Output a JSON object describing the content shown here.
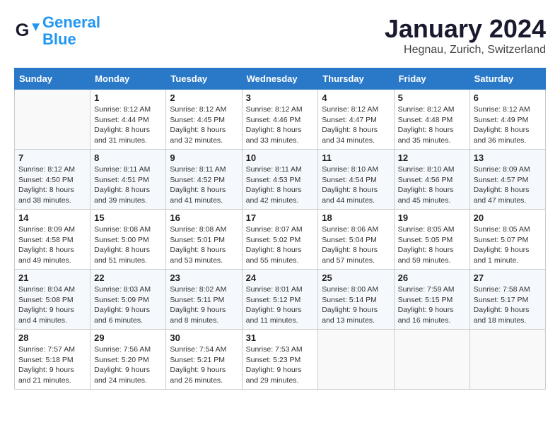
{
  "header": {
    "logo_line1": "General",
    "logo_line2": "Blue",
    "month_title": "January 2024",
    "location": "Hegnau, Zurich, Switzerland"
  },
  "weekdays": [
    "Sunday",
    "Monday",
    "Tuesday",
    "Wednesday",
    "Thursday",
    "Friday",
    "Saturday"
  ],
  "weeks": [
    [
      {
        "day": "",
        "info": ""
      },
      {
        "day": "1",
        "info": "Sunrise: 8:12 AM\nSunset: 4:44 PM\nDaylight: 8 hours\nand 31 minutes."
      },
      {
        "day": "2",
        "info": "Sunrise: 8:12 AM\nSunset: 4:45 PM\nDaylight: 8 hours\nand 32 minutes."
      },
      {
        "day": "3",
        "info": "Sunrise: 8:12 AM\nSunset: 4:46 PM\nDaylight: 8 hours\nand 33 minutes."
      },
      {
        "day": "4",
        "info": "Sunrise: 8:12 AM\nSunset: 4:47 PM\nDaylight: 8 hours\nand 34 minutes."
      },
      {
        "day": "5",
        "info": "Sunrise: 8:12 AM\nSunset: 4:48 PM\nDaylight: 8 hours\nand 35 minutes."
      },
      {
        "day": "6",
        "info": "Sunrise: 8:12 AM\nSunset: 4:49 PM\nDaylight: 8 hours\nand 36 minutes."
      }
    ],
    [
      {
        "day": "7",
        "info": "Sunrise: 8:12 AM\nSunset: 4:50 PM\nDaylight: 8 hours\nand 38 minutes."
      },
      {
        "day": "8",
        "info": "Sunrise: 8:11 AM\nSunset: 4:51 PM\nDaylight: 8 hours\nand 39 minutes."
      },
      {
        "day": "9",
        "info": "Sunrise: 8:11 AM\nSunset: 4:52 PM\nDaylight: 8 hours\nand 41 minutes."
      },
      {
        "day": "10",
        "info": "Sunrise: 8:11 AM\nSunset: 4:53 PM\nDaylight: 8 hours\nand 42 minutes."
      },
      {
        "day": "11",
        "info": "Sunrise: 8:10 AM\nSunset: 4:54 PM\nDaylight: 8 hours\nand 44 minutes."
      },
      {
        "day": "12",
        "info": "Sunrise: 8:10 AM\nSunset: 4:56 PM\nDaylight: 8 hours\nand 45 minutes."
      },
      {
        "day": "13",
        "info": "Sunrise: 8:09 AM\nSunset: 4:57 PM\nDaylight: 8 hours\nand 47 minutes."
      }
    ],
    [
      {
        "day": "14",
        "info": "Sunrise: 8:09 AM\nSunset: 4:58 PM\nDaylight: 8 hours\nand 49 minutes."
      },
      {
        "day": "15",
        "info": "Sunrise: 8:08 AM\nSunset: 5:00 PM\nDaylight: 8 hours\nand 51 minutes."
      },
      {
        "day": "16",
        "info": "Sunrise: 8:08 AM\nSunset: 5:01 PM\nDaylight: 8 hours\nand 53 minutes."
      },
      {
        "day": "17",
        "info": "Sunrise: 8:07 AM\nSunset: 5:02 PM\nDaylight: 8 hours\nand 55 minutes."
      },
      {
        "day": "18",
        "info": "Sunrise: 8:06 AM\nSunset: 5:04 PM\nDaylight: 8 hours\nand 57 minutes."
      },
      {
        "day": "19",
        "info": "Sunrise: 8:05 AM\nSunset: 5:05 PM\nDaylight: 8 hours\nand 59 minutes."
      },
      {
        "day": "20",
        "info": "Sunrise: 8:05 AM\nSunset: 5:07 PM\nDaylight: 9 hours\nand 1 minute."
      }
    ],
    [
      {
        "day": "21",
        "info": "Sunrise: 8:04 AM\nSunset: 5:08 PM\nDaylight: 9 hours\nand 4 minutes."
      },
      {
        "day": "22",
        "info": "Sunrise: 8:03 AM\nSunset: 5:09 PM\nDaylight: 9 hours\nand 6 minutes."
      },
      {
        "day": "23",
        "info": "Sunrise: 8:02 AM\nSunset: 5:11 PM\nDaylight: 9 hours\nand 8 minutes."
      },
      {
        "day": "24",
        "info": "Sunrise: 8:01 AM\nSunset: 5:12 PM\nDaylight: 9 hours\nand 11 minutes."
      },
      {
        "day": "25",
        "info": "Sunrise: 8:00 AM\nSunset: 5:14 PM\nDaylight: 9 hours\nand 13 minutes."
      },
      {
        "day": "26",
        "info": "Sunrise: 7:59 AM\nSunset: 5:15 PM\nDaylight: 9 hours\nand 16 minutes."
      },
      {
        "day": "27",
        "info": "Sunrise: 7:58 AM\nSunset: 5:17 PM\nDaylight: 9 hours\nand 18 minutes."
      }
    ],
    [
      {
        "day": "28",
        "info": "Sunrise: 7:57 AM\nSunset: 5:18 PM\nDaylight: 9 hours\nand 21 minutes."
      },
      {
        "day": "29",
        "info": "Sunrise: 7:56 AM\nSunset: 5:20 PM\nDaylight: 9 hours\nand 24 minutes."
      },
      {
        "day": "30",
        "info": "Sunrise: 7:54 AM\nSunset: 5:21 PM\nDaylight: 9 hours\nand 26 minutes."
      },
      {
        "day": "31",
        "info": "Sunrise: 7:53 AM\nSunset: 5:23 PM\nDaylight: 9 hours\nand 29 minutes."
      },
      {
        "day": "",
        "info": ""
      },
      {
        "day": "",
        "info": ""
      },
      {
        "day": "",
        "info": ""
      }
    ]
  ]
}
